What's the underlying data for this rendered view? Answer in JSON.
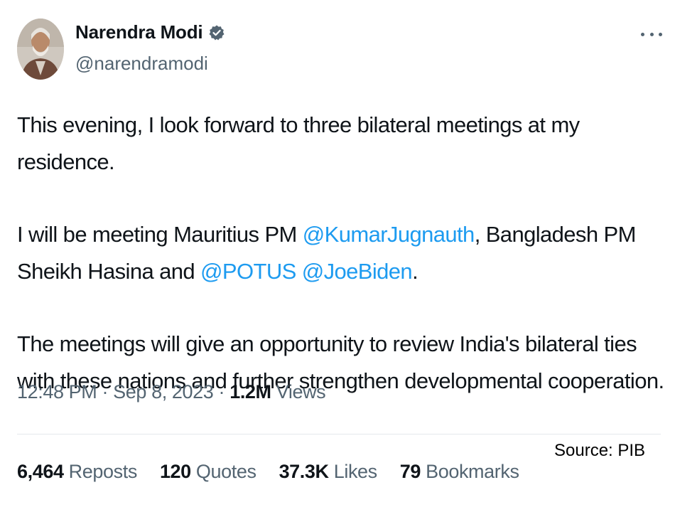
{
  "author": {
    "display_name": "Narendra Modi",
    "handle": "@narendramodi",
    "verified_icon": "verified-badge-icon",
    "verified_color": "#536471"
  },
  "more_icon": "more-options-icon",
  "tweet": {
    "para1": "This evening, I look forward to three bilateral meetings at my residence.",
    "para2": {
      "t1": "I will be meeting Mauritius PM ",
      "m1": "@KumarJugnauth",
      "t2": ", Bangladesh PM Sheikh Hasina and ",
      "m2": "@POTUS",
      "t3": " ",
      "m3": "@JoeBiden",
      "t4": "."
    },
    "para3": "The meetings will give an opportunity to review India's bilateral ties with these nations and further strengthen developmental cooperation."
  },
  "meta": {
    "time": "12:48 PM",
    "sep1": " · ",
    "date": "Sep 8, 2023",
    "sep2": " · ",
    "views_count": "1.2M",
    "views_label": " Views"
  },
  "source": "Source: PIB",
  "stats": [
    {
      "count": "6,464",
      "label": " Reposts"
    },
    {
      "count": "120",
      "label": " Quotes"
    },
    {
      "count": "37.3K",
      "label": " Likes"
    },
    {
      "count": "79",
      "label": " Bookmarks"
    }
  ],
  "colors": {
    "link": "#1d9bf0",
    "secondary_text": "#536471",
    "primary_text": "#0f1419"
  }
}
